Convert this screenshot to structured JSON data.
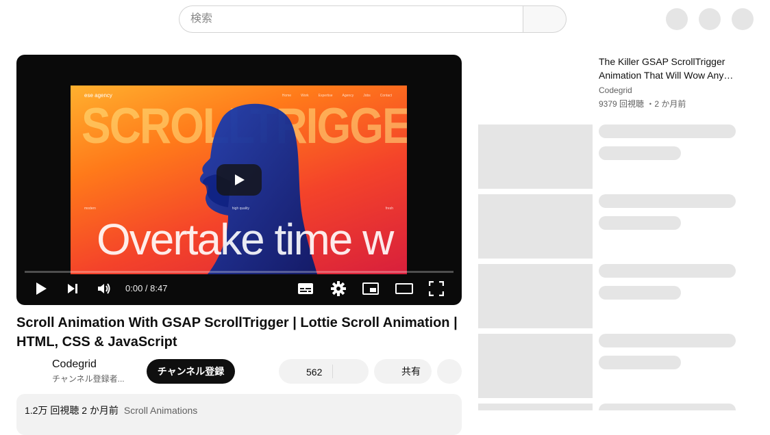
{
  "search": {
    "placeholder": "検索"
  },
  "player": {
    "thumbnail": {
      "brand": "ese agency",
      "nav": [
        "Home",
        "Work",
        "Expertise",
        "Agency",
        "Jobs",
        "Contact"
      ],
      "headline": "SCROLLTRIGGER + GSAP+LOTTIE",
      "tags": [
        "modern",
        "high quality",
        "fresh"
      ],
      "big_text": "Overtake time w"
    },
    "time": "0:00 / 8:47",
    "progress": 0.0
  },
  "video": {
    "title": "Scroll Animation With GSAP ScrollTrigger | Lottie Scroll Animation | HTML, CSS & JavaScript",
    "channel": "Codegrid",
    "subscribers": "チャンネル登録者...",
    "subscribe_label": "チャンネル登録",
    "likes": "562",
    "share_label": "共有",
    "views_date": "1.2万 回視聴  2 か月前",
    "playlist_tag": "Scroll Animations"
  },
  "sidebar": {
    "first": {
      "title": "The Killer GSAP ScrollTrigger Animation That Will Wow Any…",
      "channel": "Codegrid",
      "meta": "9379 回視聴 ・2 か月前"
    }
  },
  "colors": {
    "skeleton": "#e5e5e5",
    "subscribe_bg": "#0f0f0f",
    "pill_bg": "#f2f2f2"
  }
}
